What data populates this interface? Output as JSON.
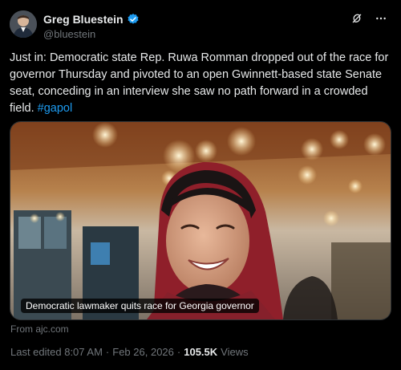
{
  "author": {
    "name": "Greg Bluestein",
    "handle": "@bluestein",
    "verified_color": "#1d9bf0"
  },
  "tweet": {
    "text": "Just in: Democratic state Rep. Ruwa Romman dropped out of the race for governor Thursday and pivoted to an open Gwinnett-based state Senate seat, conceding in an interview she saw no path forward in a crowded field.",
    "hashtag": "#gapol"
  },
  "card": {
    "caption": "Democratic lawmaker quits race for Georgia governor",
    "source": "From ajc.com"
  },
  "meta": {
    "edited": "Last edited 8:07 AM",
    "separator": "·",
    "date": "Feb 26, 2026",
    "views_count": "105.5K",
    "views_label": "Views"
  },
  "icons": {
    "verified": "verified-badge-icon",
    "grok": "grok-icon",
    "more": "more-icon"
  }
}
